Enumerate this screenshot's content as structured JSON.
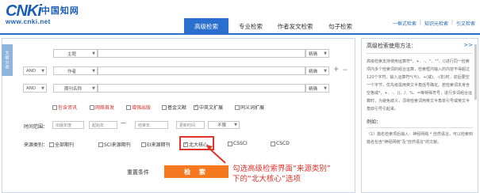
{
  "logo": {
    "brand": "CNKi",
    "cn": "中国知网",
    "url": "www.cnki.net"
  },
  "top_links": [
    "一框式检索",
    "知识元检索",
    "引文检索"
  ],
  "tabs": [
    "高级检索",
    "专业检索",
    "作者发文检索",
    "句子检索"
  ],
  "side_tab": "文献分类",
  "rows": [
    {
      "logic": "",
      "field": "主题",
      "match": "精确"
    },
    {
      "logic": "AND",
      "field": "作者",
      "match": "精确"
    },
    {
      "logic": "AND",
      "field": "期刊名称",
      "match": "精确"
    }
  ],
  "plus": "+",
  "minus": "—",
  "options": [
    "包含资讯",
    "网络首发",
    "增强出版",
    "基金文献",
    "中英文扩展",
    "同义词扩展"
  ],
  "time": {
    "label": "时间范围：",
    "pub_label": "出版年度",
    "start": "起始年",
    "dash": "—",
    "end": "结束年",
    "update": "更新时间",
    "update_value": "不限"
  },
  "source": {
    "label": "来源类别：",
    "items": [
      "全部期刊",
      "SCI来源期刊",
      "EI来源期刊",
      "北大核心",
      "CSSCI",
      "CSCD"
    ]
  },
  "reset": "重置条件",
  "search": "检 索",
  "annotation": [
    "勾选高级检索界面“来源类别”",
    "下的“北大核心”选项"
  ],
  "help": {
    "title": "高级检索使用方法：",
    "more": ">>",
    "body": "高级检索支持使用运算符*、+、-、''、\"\"、()进行同一检索项内多个检索词的组合运算，检索框内输入的内容不得超过120个字符。输入运算符*(与)、+(或)、-(非)时，前后要空一个字节，优先级需用英文半角括号确定。若检索词本身含空格或*、+、-、()、/、%、=等特殊符号，进行多词组合运算时，为避免歧义，须将检索词用英文半角单引号或英文半角双引号引起来。",
    "example_label": "例如：",
    "example": "（1）篇名检索项后输入：神经网络 * 自然语言，可以检索到篇名包含\"神经网络\"及\"自然语言\"的文献。"
  }
}
